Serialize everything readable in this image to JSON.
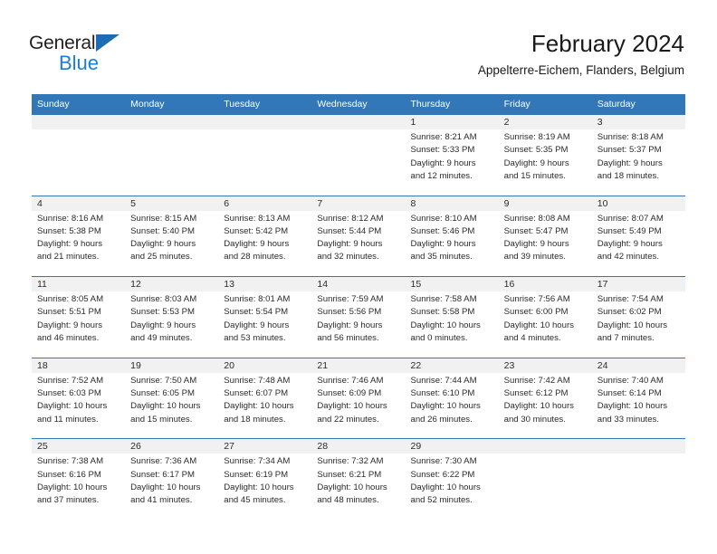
{
  "brand": {
    "name_part1": "General",
    "name_part2": "Blue",
    "accent_color": "#1b7fd4",
    "header_color": "#3278b9"
  },
  "header": {
    "title": "February 2024",
    "subtitle": "Appelterre-Eichem, Flanders, Belgium"
  },
  "weekdays": [
    "Sunday",
    "Monday",
    "Tuesday",
    "Wednesday",
    "Thursday",
    "Friday",
    "Saturday"
  ],
  "weeks": [
    [
      {
        "day": "",
        "sunrise": "",
        "sunset": "",
        "daylight1": "",
        "daylight2": ""
      },
      {
        "day": "",
        "sunrise": "",
        "sunset": "",
        "daylight1": "",
        "daylight2": ""
      },
      {
        "day": "",
        "sunrise": "",
        "sunset": "",
        "daylight1": "",
        "daylight2": ""
      },
      {
        "day": "",
        "sunrise": "",
        "sunset": "",
        "daylight1": "",
        "daylight2": ""
      },
      {
        "day": "1",
        "sunrise": "Sunrise: 8:21 AM",
        "sunset": "Sunset: 5:33 PM",
        "daylight1": "Daylight: 9 hours",
        "daylight2": "and 12 minutes."
      },
      {
        "day": "2",
        "sunrise": "Sunrise: 8:19 AM",
        "sunset": "Sunset: 5:35 PM",
        "daylight1": "Daylight: 9 hours",
        "daylight2": "and 15 minutes."
      },
      {
        "day": "3",
        "sunrise": "Sunrise: 8:18 AM",
        "sunset": "Sunset: 5:37 PM",
        "daylight1": "Daylight: 9 hours",
        "daylight2": "and 18 minutes."
      }
    ],
    [
      {
        "day": "4",
        "sunrise": "Sunrise: 8:16 AM",
        "sunset": "Sunset: 5:38 PM",
        "daylight1": "Daylight: 9 hours",
        "daylight2": "and 21 minutes."
      },
      {
        "day": "5",
        "sunrise": "Sunrise: 8:15 AM",
        "sunset": "Sunset: 5:40 PM",
        "daylight1": "Daylight: 9 hours",
        "daylight2": "and 25 minutes."
      },
      {
        "day": "6",
        "sunrise": "Sunrise: 8:13 AM",
        "sunset": "Sunset: 5:42 PM",
        "daylight1": "Daylight: 9 hours",
        "daylight2": "and 28 minutes."
      },
      {
        "day": "7",
        "sunrise": "Sunrise: 8:12 AM",
        "sunset": "Sunset: 5:44 PM",
        "daylight1": "Daylight: 9 hours",
        "daylight2": "and 32 minutes."
      },
      {
        "day": "8",
        "sunrise": "Sunrise: 8:10 AM",
        "sunset": "Sunset: 5:46 PM",
        "daylight1": "Daylight: 9 hours",
        "daylight2": "and 35 minutes."
      },
      {
        "day": "9",
        "sunrise": "Sunrise: 8:08 AM",
        "sunset": "Sunset: 5:47 PM",
        "daylight1": "Daylight: 9 hours",
        "daylight2": "and 39 minutes."
      },
      {
        "day": "10",
        "sunrise": "Sunrise: 8:07 AM",
        "sunset": "Sunset: 5:49 PM",
        "daylight1": "Daylight: 9 hours",
        "daylight2": "and 42 minutes."
      }
    ],
    [
      {
        "day": "11",
        "sunrise": "Sunrise: 8:05 AM",
        "sunset": "Sunset: 5:51 PM",
        "daylight1": "Daylight: 9 hours",
        "daylight2": "and 46 minutes."
      },
      {
        "day": "12",
        "sunrise": "Sunrise: 8:03 AM",
        "sunset": "Sunset: 5:53 PM",
        "daylight1": "Daylight: 9 hours",
        "daylight2": "and 49 minutes."
      },
      {
        "day": "13",
        "sunrise": "Sunrise: 8:01 AM",
        "sunset": "Sunset: 5:54 PM",
        "daylight1": "Daylight: 9 hours",
        "daylight2": "and 53 minutes."
      },
      {
        "day": "14",
        "sunrise": "Sunrise: 7:59 AM",
        "sunset": "Sunset: 5:56 PM",
        "daylight1": "Daylight: 9 hours",
        "daylight2": "and 56 minutes."
      },
      {
        "day": "15",
        "sunrise": "Sunrise: 7:58 AM",
        "sunset": "Sunset: 5:58 PM",
        "daylight1": "Daylight: 10 hours",
        "daylight2": "and 0 minutes."
      },
      {
        "day": "16",
        "sunrise": "Sunrise: 7:56 AM",
        "sunset": "Sunset: 6:00 PM",
        "daylight1": "Daylight: 10 hours",
        "daylight2": "and 4 minutes."
      },
      {
        "day": "17",
        "sunrise": "Sunrise: 7:54 AM",
        "sunset": "Sunset: 6:02 PM",
        "daylight1": "Daylight: 10 hours",
        "daylight2": "and 7 minutes."
      }
    ],
    [
      {
        "day": "18",
        "sunrise": "Sunrise: 7:52 AM",
        "sunset": "Sunset: 6:03 PM",
        "daylight1": "Daylight: 10 hours",
        "daylight2": "and 11 minutes."
      },
      {
        "day": "19",
        "sunrise": "Sunrise: 7:50 AM",
        "sunset": "Sunset: 6:05 PM",
        "daylight1": "Daylight: 10 hours",
        "daylight2": "and 15 minutes."
      },
      {
        "day": "20",
        "sunrise": "Sunrise: 7:48 AM",
        "sunset": "Sunset: 6:07 PM",
        "daylight1": "Daylight: 10 hours",
        "daylight2": "and 18 minutes."
      },
      {
        "day": "21",
        "sunrise": "Sunrise: 7:46 AM",
        "sunset": "Sunset: 6:09 PM",
        "daylight1": "Daylight: 10 hours",
        "daylight2": "and 22 minutes."
      },
      {
        "day": "22",
        "sunrise": "Sunrise: 7:44 AM",
        "sunset": "Sunset: 6:10 PM",
        "daylight1": "Daylight: 10 hours",
        "daylight2": "and 26 minutes."
      },
      {
        "day": "23",
        "sunrise": "Sunrise: 7:42 AM",
        "sunset": "Sunset: 6:12 PM",
        "daylight1": "Daylight: 10 hours",
        "daylight2": "and 30 minutes."
      },
      {
        "day": "24",
        "sunrise": "Sunrise: 7:40 AM",
        "sunset": "Sunset: 6:14 PM",
        "daylight1": "Daylight: 10 hours",
        "daylight2": "and 33 minutes."
      }
    ],
    [
      {
        "day": "25",
        "sunrise": "Sunrise: 7:38 AM",
        "sunset": "Sunset: 6:16 PM",
        "daylight1": "Daylight: 10 hours",
        "daylight2": "and 37 minutes."
      },
      {
        "day": "26",
        "sunrise": "Sunrise: 7:36 AM",
        "sunset": "Sunset: 6:17 PM",
        "daylight1": "Daylight: 10 hours",
        "daylight2": "and 41 minutes."
      },
      {
        "day": "27",
        "sunrise": "Sunrise: 7:34 AM",
        "sunset": "Sunset: 6:19 PM",
        "daylight1": "Daylight: 10 hours",
        "daylight2": "and 45 minutes."
      },
      {
        "day": "28",
        "sunrise": "Sunrise: 7:32 AM",
        "sunset": "Sunset: 6:21 PM",
        "daylight1": "Daylight: 10 hours",
        "daylight2": "and 48 minutes."
      },
      {
        "day": "29",
        "sunrise": "Sunrise: 7:30 AM",
        "sunset": "Sunset: 6:22 PM",
        "daylight1": "Daylight: 10 hours",
        "daylight2": "and 52 minutes."
      },
      {
        "day": "",
        "sunrise": "",
        "sunset": "",
        "daylight1": "",
        "daylight2": ""
      },
      {
        "day": "",
        "sunrise": "",
        "sunset": "",
        "daylight1": "",
        "daylight2": ""
      }
    ]
  ]
}
